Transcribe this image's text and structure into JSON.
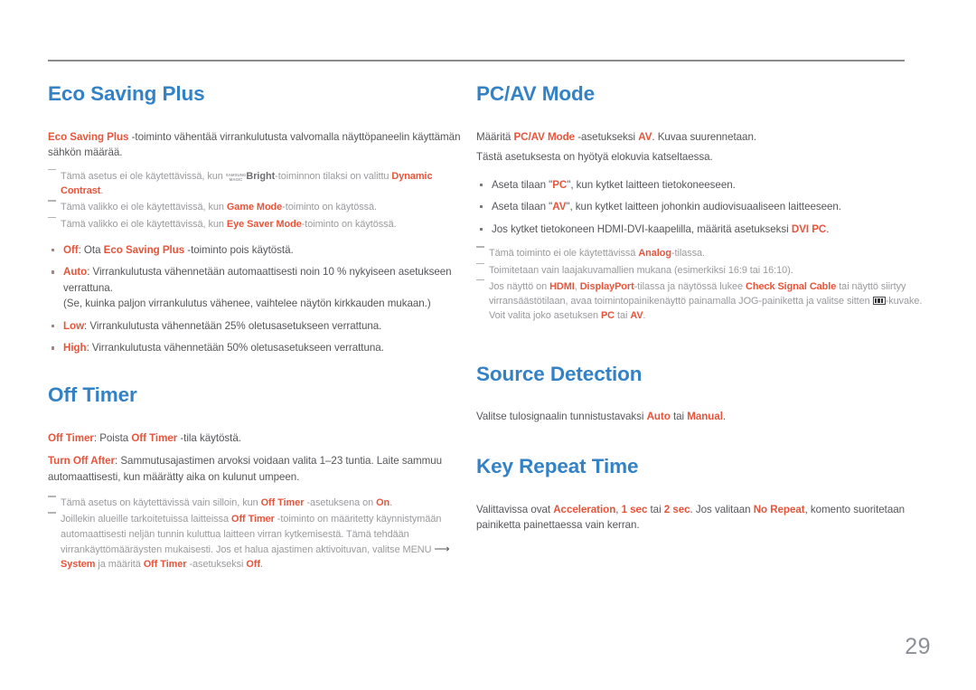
{
  "page": {
    "number": "29",
    "colors": {
      "heading_blue": "#3382c6",
      "accent_orange": "#e8543a",
      "body_gray": "#56565a",
      "note_gray": "#9a9a9e",
      "rule_gray": "#8b8b90",
      "page_number_gray": "#8e9099"
    }
  },
  "left_column": {
    "sections": [
      {
        "title": "Eco Saving Plus",
        "intro": {
          "lead": "Eco Saving Plus",
          "rest": " -toiminto vähentää virrankulutusta valvomalla näyttöpaneelin käyttämän sähkön määrää."
        },
        "notes": [
          {
            "prefix": "Tämä asetus ei ole käytettävissä, kun ",
            "magic_top": "SAMSUNG",
            "magic_bottom": "MAGIC",
            "magic_suffix": "Bright",
            "middle": "-toiminnon tilaksi on valittu ",
            "accent": "Dynamic Contrast",
            "suffix": "."
          },
          {
            "prefix": "Tämä valikko ei ole käytettävissä, kun ",
            "accent": "Game Mode",
            "suffix": "-toiminto on käytössä."
          },
          {
            "prefix": "Tämä valikko ei ole käytettävissä, kun ",
            "accent": "Eye Saver Mode",
            "suffix": "-toiminto on käytössä."
          }
        ],
        "bullets": [
          {
            "label": "Off",
            "text": ": Ota ",
            "accent2": "Eco Saving Plus",
            "text2": " -toiminto pois käytöstä."
          },
          {
            "label": "Auto",
            "text": ": Virrankulutusta vähennetään automaattisesti noin 10 % nykyiseen asetukseen verrattuna.",
            "subline": "(Se, kuinka paljon virrankulutus vähenee, vaihtelee näytön kirkkauden mukaan.)"
          },
          {
            "label": "Low",
            "text": ": Virrankulutusta vähennetään 25% oletusasetukseen verrattuna."
          },
          {
            "label": "High",
            "text": ": Virrankulutusta vähennetään 50% oletusasetukseen verrattuna."
          }
        ]
      },
      {
        "title": "Off Timer",
        "paragraphs": [
          {
            "lead": "Off Timer",
            "mid": ": Poista ",
            "lead2": "Off Timer",
            "rest": " -tila käytöstä."
          },
          {
            "lead": "Turn Off After",
            "rest": ": Sammutusajastimen arvoksi voidaan valita 1–23 tuntia. Laite sammuu automaattisesti, kun määrätty aika on kulunut umpeen."
          }
        ],
        "notes": [
          {
            "prefix": "Tämä asetus on käytettävissä vain silloin, kun ",
            "accent": "Off Timer",
            "middle": " -asetuksena on ",
            "accent2": "On",
            "suffix": "."
          },
          {
            "prefix": "Joillekin alueille tarkoitetuissa laitteissa ",
            "accent": "Off Timer",
            "middle": " -toiminto on määritetty käynnistymään automaattisesti neljän tunnin kuluttua laitteen virran kytkemisestä. Tämä tehdään virrankäyttömääräysten mukaisesti. Jos et halua ajastimen aktivoituvan, valitse MENU ",
            "arrow": "⟶",
            "middle2": " ",
            "accent2": "System",
            "middle3": " ja määritä ",
            "accent3": "Off Timer",
            "middle4": " -asetukseksi ",
            "accent4": "Off",
            "suffix": "."
          }
        ]
      }
    ]
  },
  "right_column": {
    "sections": [
      {
        "title": "PC/AV Mode",
        "paragraphs": [
          {
            "prefix": "Määritä ",
            "accent": "PC/AV Mode",
            "middle": " -asetukseksi ",
            "accent2": "AV",
            "suffix": ". Kuvaa suurennetaan."
          },
          {
            "plain": "Tästä asetuksesta on hyötyä elokuvia katseltaessa."
          }
        ],
        "bullets": [
          {
            "prefix": "Aseta tilaan \"",
            "accent": "PC",
            "suffix": "\", kun kytket laitteen tietokoneeseen."
          },
          {
            "prefix": "Aseta tilaan \"",
            "accent": "AV",
            "suffix": "\", kun kytket laitteen johonkin audiovisuaaliseen laitteeseen."
          },
          {
            "prefix": "Jos kytket tietokoneen HDMI-DVI-kaapelilla, määritä asetukseksi ",
            "accent": "DVI PC",
            "suffix": "."
          }
        ],
        "notes": [
          {
            "prefix": "Tämä toiminto ei ole käytettävissä ",
            "accent": "Analog",
            "suffix": "-tilassa."
          },
          {
            "plain": "Toimitetaan vain laajakuvamallien mukana (esimerkiksi 16:9 tai 16:10)."
          },
          {
            "prefix": "Jos näyttö on ",
            "accent": "HDMI",
            "middle": ", ",
            "accent2": "DisplayPort",
            "middle2": "-tilassa ja näytössä lukee ",
            "accent3": "Check Signal Cable",
            "middle3": " tai näyttö siirtyy virransäästötilaan, avaa toimintopainikenäyttö painamalla JOG-painiketta ja valitse sitten ",
            "icon": "source-input-icon",
            "middle4": "-kuvake. Voit valita joko asetuksen ",
            "accent4": "PC",
            "middle5": " tai ",
            "accent5": "AV",
            "suffix": "."
          }
        ]
      },
      {
        "title": "Source Detection",
        "paragraphs": [
          {
            "prefix": "Valitse tulosignaalin tunnistustavaksi ",
            "accent": "Auto",
            "middle": " tai ",
            "accent2": "Manual",
            "suffix": "."
          }
        ]
      },
      {
        "title": "Key Repeat Time",
        "paragraphs": [
          {
            "prefix": "Valittavissa ovat ",
            "accent": "Acceleration",
            "middle": ", ",
            "accent2": "1 sec",
            "middle2": " tai ",
            "accent3": "2 sec",
            "middle3": ". Jos valitaan ",
            "accent4": "No Repeat",
            "suffix": ", komento suoritetaan painiketta painettaessa vain kerran."
          }
        ]
      }
    ]
  }
}
